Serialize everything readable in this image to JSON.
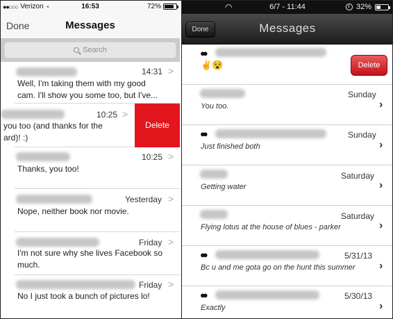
{
  "left_pane": {
    "status": {
      "carrier": "Verizon",
      "signal_dots": "●●○○○",
      "time": "16:53",
      "battery": "72%",
      "battery_level": 0.72
    },
    "nav": {
      "done_label": "Done",
      "title": "Messages"
    },
    "search": {
      "placeholder": "Search"
    },
    "rows": [
      {
        "time": "14:31",
        "message_line1": "Well, I'm taking them with my good",
        "message_line2": "cam. I'll show you some too, but I've..."
      },
      {
        "time": "10:25",
        "message_line1": "you too (and thanks for the",
        "message_line2": "ard)! :)"
      },
      {
        "time": "10:25",
        "message_line1": "Thanks, you too!"
      },
      {
        "time": "Yesterday",
        "message_line1": "Nope, neither book nor movie."
      },
      {
        "time": "Friday",
        "message_line1": "I'm not sure why she lives Facebook so",
        "message_line2": "much."
      },
      {
        "time": "Friday",
        "message_line1": "No I just took a bunch of pictures lo!"
      }
    ],
    "delete_label": "Delete"
  },
  "right_pane": {
    "status": {
      "time": "6/7 - 11:44",
      "battery": "32%",
      "battery_level": 0.32
    },
    "nav": {
      "done_label": "Done",
      "title": "Messages"
    },
    "rows": [
      {
        "time": "",
        "message": "✌️😵"
      },
      {
        "time": "Sunday",
        "message": "You too."
      },
      {
        "time": "Sunday",
        "message": "Just finished both"
      },
      {
        "time": "Saturday",
        "message": "Getting water"
      },
      {
        "time": "Saturday",
        "message": "Flying lotus at the house of blues - parker"
      },
      {
        "time": "5/31/13",
        "message": "Bc u and me gota go on the hunt this summer"
      },
      {
        "time": "5/30/13",
        "message": "Exactly"
      }
    ],
    "delete_label": "Delete"
  }
}
